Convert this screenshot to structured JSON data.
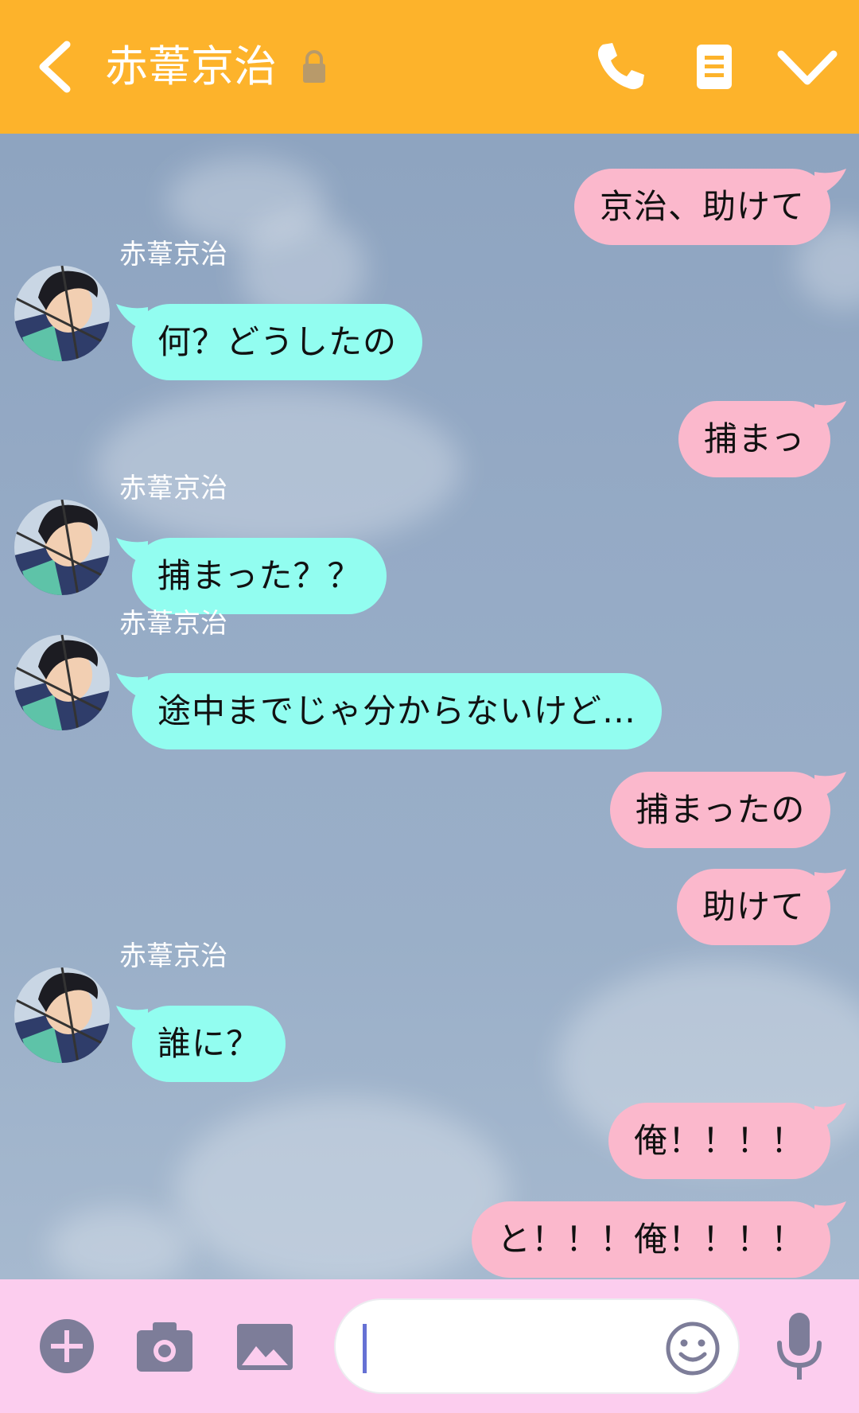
{
  "header": {
    "title": "赤葦京治",
    "background": "#fdb32b"
  },
  "chat": {
    "sent_color": "#fbb8cc",
    "received_color": "#92fdf0",
    "messages": [
      {
        "side": "sent",
        "text": "京治、助けて"
      },
      {
        "side": "received",
        "sender": "赤葦京治",
        "text": "何？どうしたの"
      },
      {
        "side": "sent",
        "text": "捕まっ"
      },
      {
        "side": "received",
        "sender": "赤葦京治",
        "text": "捕まった？？"
      },
      {
        "side": "received",
        "sender": "赤葦京治",
        "text": "途中までじゃ分からないけど…"
      },
      {
        "side": "sent",
        "text": "捕まったの"
      },
      {
        "side": "sent",
        "text": "助けて"
      },
      {
        "side": "received",
        "sender": "赤葦京治",
        "text": "誰に？"
      },
      {
        "side": "sent",
        "text": "俺！！！！"
      },
      {
        "side": "sent",
        "text": "と！！！俺！！！！"
      }
    ]
  },
  "input_bar": {
    "background": "#fccdee",
    "message_value": ""
  },
  "icons": {
    "back": "chevron-left-icon",
    "lock": "lock-icon",
    "call": "phone-icon",
    "notes": "notes-icon",
    "menu": "chevron-down-icon",
    "add": "plus-circle-icon",
    "camera": "camera-icon",
    "image": "image-icon",
    "emoji": "smiley-icon",
    "mic": "microphone-icon"
  }
}
